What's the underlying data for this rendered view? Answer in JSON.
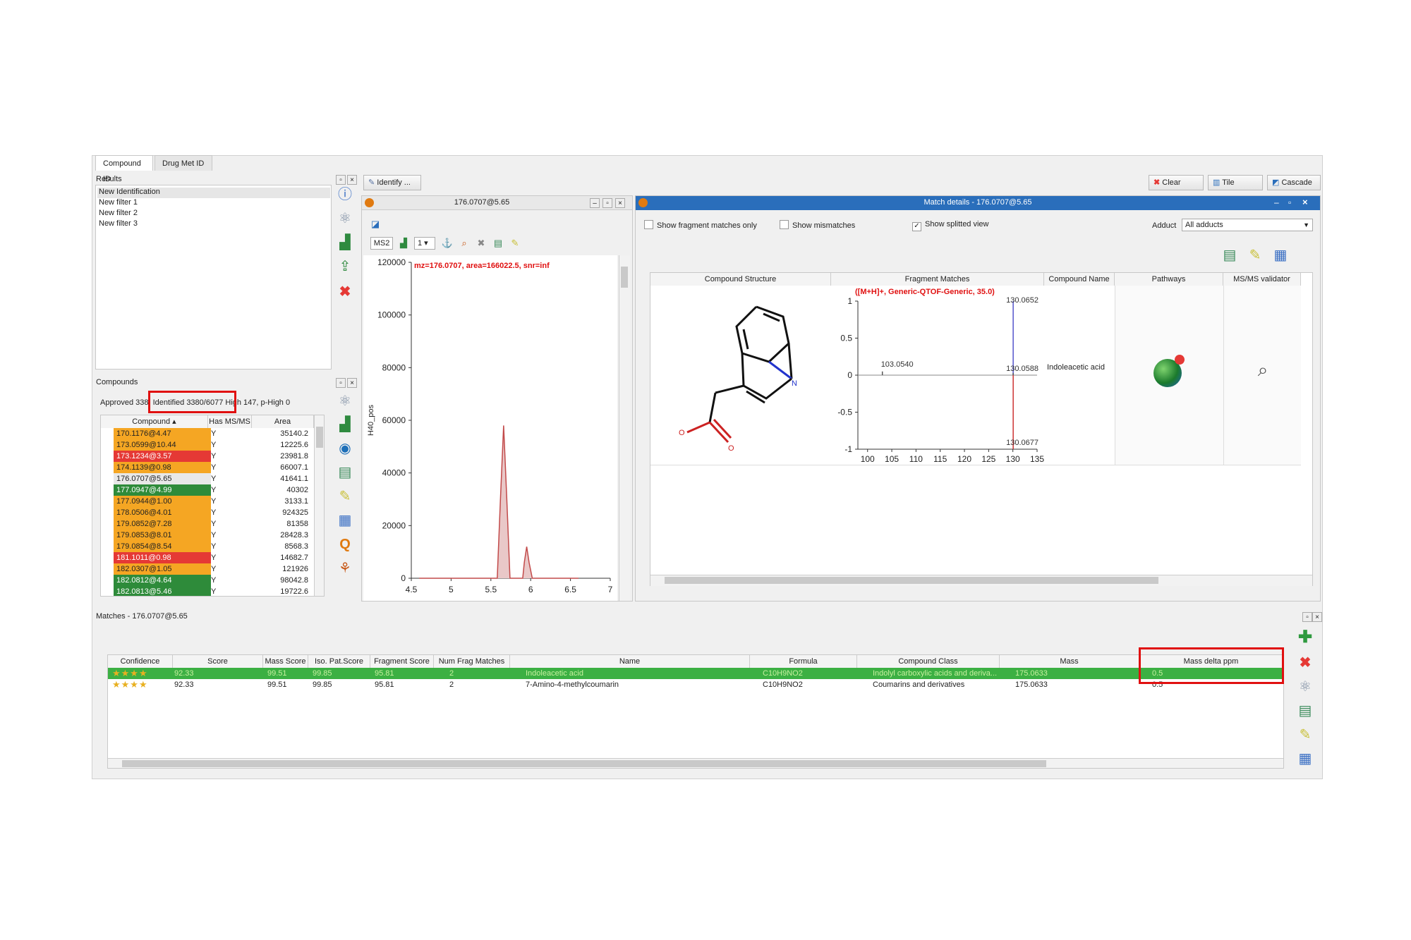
{
  "tabs": [
    {
      "label": "Compound ID",
      "active": true
    },
    {
      "label": "Drug Met ID",
      "active": false
    }
  ],
  "results": {
    "title": "Results",
    "items": [
      "New Identification",
      "New filter 1",
      "New filter 2",
      "New filter 3"
    ]
  },
  "compounds": {
    "title": "Compounds",
    "status_prefix": "Approved 338",
    "status_identified": ", Identified 3380/6077",
    "status_suffix": "High 147, p-High 0",
    "columns": [
      "Compound",
      "Has MS/MS",
      "Area"
    ],
    "rows": [
      {
        "compound": "170.1176@4.47",
        "has_msms": "Y",
        "area": "35140.2",
        "color": "#f5a623"
      },
      {
        "compound": "173.0599@10.44",
        "has_msms": "Y",
        "area": "12225.6",
        "color": "#f5a623"
      },
      {
        "compound": "173.1234@3.57",
        "has_msms": "Y",
        "area": "23981.8",
        "color": "#e53935"
      },
      {
        "compound": "174.1139@0.98",
        "has_msms": "Y",
        "area": "66007.1",
        "color": "#f5a623"
      },
      {
        "compound": "176.0707@5.65",
        "has_msms": "Y",
        "area": "41641.1",
        "color": "#e8e8e8"
      },
      {
        "compound": "177.0947@4.99",
        "has_msms": "Y",
        "area": "40302",
        "color": "#2e8b3a"
      },
      {
        "compound": "177.0944@1.00",
        "has_msms": "Y",
        "area": "3133.1",
        "color": "#f5a623"
      },
      {
        "compound": "178.0506@4.01",
        "has_msms": "Y",
        "area": "924325",
        "color": "#f5a623"
      },
      {
        "compound": "179.0852@7.28",
        "has_msms": "Y",
        "area": "81358",
        "color": "#f5a623"
      },
      {
        "compound": "179.0853@8.01",
        "has_msms": "Y",
        "area": "28428.3",
        "color": "#f5a623"
      },
      {
        "compound": "179.0854@8.54",
        "has_msms": "Y",
        "area": "8568.3",
        "color": "#f5a623"
      },
      {
        "compound": "181.1011@0.98",
        "has_msms": "Y",
        "area": "14682.7",
        "color": "#e53935"
      },
      {
        "compound": "182.0307@1.05",
        "has_msms": "Y",
        "area": "121926",
        "color": "#f5a623"
      },
      {
        "compound": "182.0812@4.64",
        "has_msms": "Y",
        "area": "98042.8",
        "color": "#2e8b3a"
      },
      {
        "compound": "182.0813@5.46",
        "has_msms": "Y",
        "area": "19722.6",
        "color": "#2e8b3a"
      }
    ]
  },
  "toolbar": {
    "identify_label": "Identify ...",
    "clear_label": "Clear",
    "tile_label": "Tile",
    "cascade_label": "Cascade"
  },
  "chrom_window": {
    "title": "176.0707@5.65",
    "ms_select": "MS2",
    "num_select": "1"
  },
  "chart_data": {
    "type": "line",
    "title": "mz=176.0707, area=166022.5, snr=inf",
    "ylabel": "H40_pos",
    "xlabel": "",
    "xlim": [
      4.5,
      7
    ],
    "ylim": [
      0,
      120000
    ],
    "x_ticks": [
      "4.5",
      "5",
      "5.5",
      "6",
      "6.5",
      "7"
    ],
    "y_ticks": [
      "0",
      "20000",
      "40000",
      "60000",
      "80000",
      "100000",
      "120000"
    ],
    "series": [
      {
        "x": [
          4.6,
          5.5,
          5.58,
          5.62,
          5.66,
          5.7,
          5.74,
          5.78,
          5.9,
          5.92,
          5.95,
          5.98,
          6.02,
          6.6
        ],
        "y": [
          0,
          0,
          0,
          30000,
          58000,
          30000,
          0,
          0,
          0,
          6000,
          12000,
          6000,
          0,
          0
        ]
      }
    ],
    "color": "#c24a4a"
  },
  "match_window": {
    "title": "Match details - 176.0707@5.65",
    "show_fragment_only": "Show fragment matches only",
    "show_mismatches": "Show mismatches",
    "show_splitted": "Show splitted view",
    "adduct_label": "Adduct",
    "adduct_value": "All adducts",
    "columns": [
      "Compound Structure",
      "Fragment Matches",
      "Compound Name",
      "Pathways",
      "MS/MS validator"
    ],
    "compound_name": "Indoleacetic acid",
    "atom_labels": {
      "o1": "O",
      "o2": "O",
      "n": "N"
    }
  },
  "fragment_chart": {
    "type": "bar",
    "title": "([M+H]+, Generic-QTOF-Generic, 35.0)",
    "xlim": [
      98,
      135
    ],
    "ylim": [
      -1,
      1
    ],
    "x_ticks": [
      "100",
      "105",
      "110",
      "115",
      "120",
      "125",
      "130",
      "135"
    ],
    "y_ticks": [
      "1",
      "0.5",
      "0",
      "-0.5",
      "-1"
    ],
    "peaks": [
      {
        "mz": 130.0652,
        "intensity": 1,
        "label": "130.0652",
        "color": "#5555cc"
      },
      {
        "mz": 103.054,
        "intensity": 0.05,
        "label": "103.0540",
        "color": "#555555"
      },
      {
        "mz": 130.0588,
        "intensity": 0.03,
        "label": "130.0588",
        "color": "#555555"
      },
      {
        "mz": 130.0677,
        "intensity": -1,
        "label": "130.0677",
        "color": "#cc3333"
      }
    ]
  },
  "matches": {
    "title": "Matches - 176.0707@5.65",
    "columns": [
      "Confidence",
      "Score",
      "Mass Score",
      "Iso. Pat.Score",
      "Fragment Score",
      "Num Frag Matches",
      "Name",
      "Formula",
      "Compound Class",
      "Mass",
      "Mass delta ppm"
    ],
    "rows": [
      {
        "stars": "★★★★",
        "score": "92.33",
        "mass_score": "99.51",
        "iso": "99.85",
        "frag": "95.81",
        "num": "2",
        "name": "Indoleacetic acid",
        "formula": "C10H9NO2",
        "class": "Indolyl carboxylic acids and deriva...",
        "mass": "175.0633",
        "delta": "0.5",
        "selected": true
      },
      {
        "stars": "★★★★",
        "score": "92.33",
        "mass_score": "99.51",
        "iso": "99.85",
        "frag": "95.81",
        "num": "2",
        "name": "7-Amino-4-methylcoumarin",
        "formula": "C10H9NO2",
        "class": "Coumarins and derivatives",
        "mass": "175.0633",
        "delta": "0.5",
        "selected": false
      }
    ]
  },
  "colors": {
    "highlight": "#e01010",
    "selected_row": "#3cb043",
    "title_bar": "#2a6ebb"
  }
}
